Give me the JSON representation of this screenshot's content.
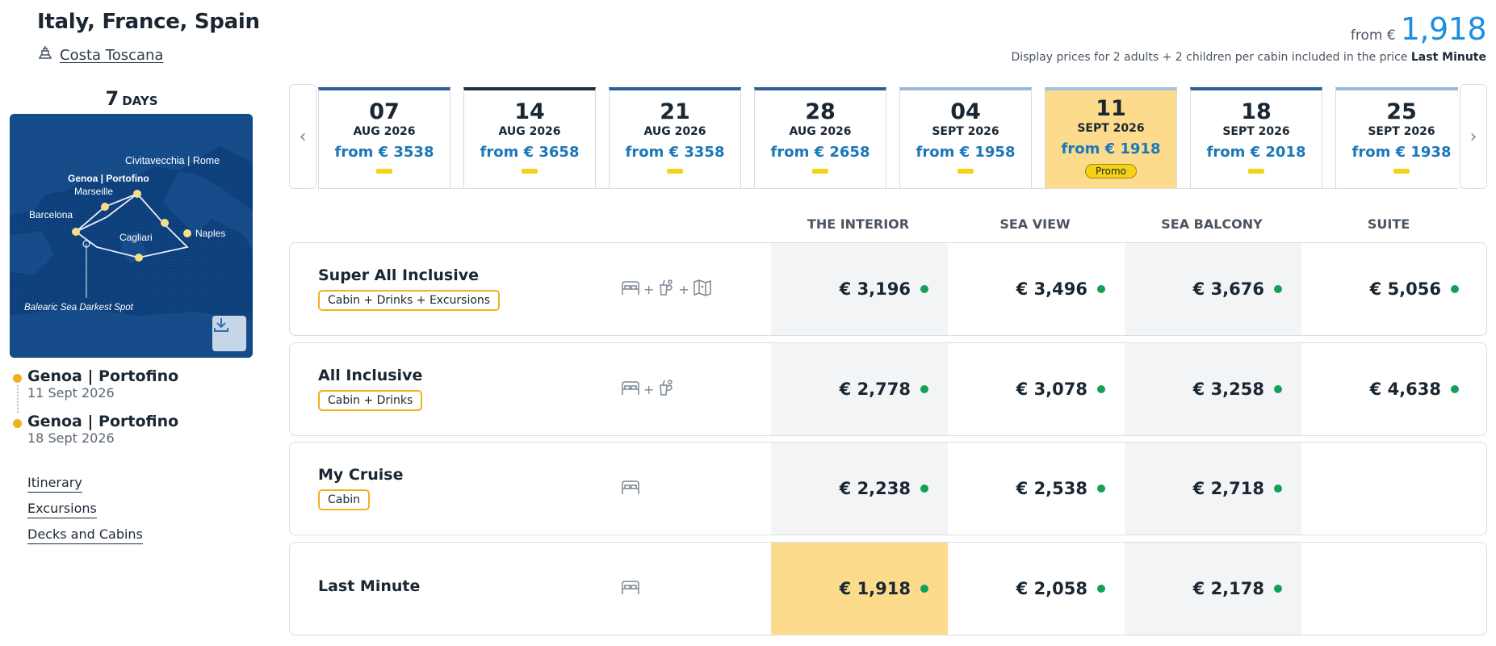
{
  "header": {
    "title": "Italy, France, Spain",
    "ship": "Costa Toscana",
    "price_from_label": "from €",
    "price_from_amount": "1,918",
    "price_note": "Display prices for 2 adults + 2 children per cabin included in the price",
    "price_note_bold": "Last Minute"
  },
  "duration": {
    "number": "7",
    "label": "DAYS"
  },
  "map": {
    "ports": [
      "Civitavecchia | Rome",
      "Genoa | Portofino",
      "Marseille",
      "Barcelona",
      "Cagliari",
      "Naples"
    ],
    "spot": "Balearic Sea Darkest Spot",
    "download_icon": "download-icon"
  },
  "timeline": [
    {
      "port": "Genoa | Portofino",
      "date": "11 Sept 2026"
    },
    {
      "port": "Genoa | Portofino",
      "date": "18 Sept 2026"
    }
  ],
  "links": [
    "Itinerary",
    "Excursions",
    "Decks and Cabins"
  ],
  "dates": [
    {
      "day": "07",
      "month": "AUG 2026",
      "price": "from € 3538",
      "style": "normal"
    },
    {
      "day": "14",
      "month": "AUG 2026",
      "price": "from € 3658",
      "style": "dark"
    },
    {
      "day": "21",
      "month": "AUG 2026",
      "price": "from € 3358",
      "style": "normal"
    },
    {
      "day": "28",
      "month": "AUG 2026",
      "price": "from € 2658",
      "style": "normal"
    },
    {
      "day": "04",
      "month": "SEPT 2026",
      "price": "from € 1958",
      "style": "light"
    },
    {
      "day": "11",
      "month": "SEPT 2026",
      "price": "from € 1918",
      "style": "active",
      "badge": "Promo"
    },
    {
      "day": "18",
      "month": "SEPT 2026",
      "price": "from € 2018",
      "style": "normal"
    },
    {
      "day": "25",
      "month": "SEPT 2026",
      "price": "from € 1938",
      "style": "light"
    }
  ],
  "columns": [
    "THE INTERIOR",
    "SEA VIEW",
    "SEA BALCONY",
    "SUITE"
  ],
  "packages": [
    {
      "name": "Super All Inclusive",
      "badge": "Cabin + Drinks + Excursions",
      "icons": [
        "bed-icon",
        "drink-icon",
        "map-icon"
      ],
      "prices": [
        "€ 3,196",
        "€ 3,496",
        "€ 3,676",
        "€ 5,056"
      ]
    },
    {
      "name": "All Inclusive",
      "badge": "Cabin + Drinks",
      "icons": [
        "bed-icon",
        "drink-icon"
      ],
      "prices": [
        "€ 2,778",
        "€ 3,078",
        "€ 3,258",
        "€ 4,638"
      ]
    },
    {
      "name": "My Cruise",
      "badge": "Cabin",
      "icons": [
        "bed-icon"
      ],
      "prices": [
        "€ 2,238",
        "€ 2,538",
        "€ 2,718",
        ""
      ]
    },
    {
      "name": "Last Minute",
      "badge": "",
      "icons": [
        "bed-icon"
      ],
      "prices": [
        "€ 1,918",
        "€ 2,058",
        "€ 2,178",
        ""
      ]
    }
  ],
  "colors": {
    "accent": "#1e8fe0",
    "highlight": "#fcdb8d",
    "badge_border": "#f2b01e",
    "available": "#14a05a"
  }
}
